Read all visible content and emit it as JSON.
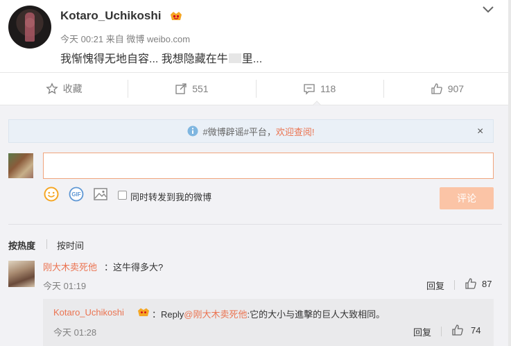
{
  "post": {
    "username": "Kotaro_Uchikoshi",
    "meta": "今天 00:21 来自 微博 weibo.com",
    "text": "我惭愧得无地自容... 我想隐藏在牛",
    "text_tail": "里..."
  },
  "actions": {
    "favorite_label": "收藏",
    "repost_count": "551",
    "comment_count": "118",
    "like_count": "907"
  },
  "notice": {
    "text": "#微博辟谣#平台，",
    "link": "欢迎查阅!",
    "close": "×"
  },
  "composer": {
    "input_value": "",
    "repost_label": "同时转发到我的微博",
    "submit_label": "评论"
  },
  "sort": {
    "hot": "按热度",
    "time": "按时间"
  },
  "comments": [
    {
      "name": "刚大木卖死他",
      "text": "：这牛得多大?",
      "time": "今天 01:19",
      "reply_label": "回复",
      "likes": "87"
    }
  ],
  "reply": {
    "name": "Kotaro_Uchikoshi",
    "prefix": "：Reply",
    "at": "@刚大木卖死他",
    "text": ":它的大小与進擊的巨人大致相同。",
    "time": "今天 01:28",
    "reply_label": "回复",
    "likes": "74"
  },
  "colors": {
    "accent": "#eb7350",
    "button_disabled": "#fbc4a6",
    "notice_bg": "#eaf0f7"
  }
}
